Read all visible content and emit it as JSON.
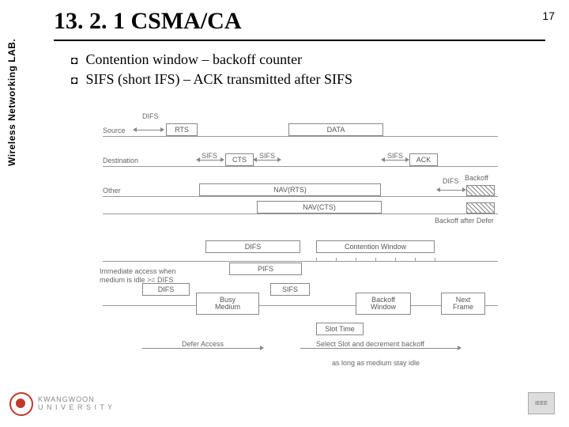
{
  "page": {
    "number": "17"
  },
  "sidebar": {
    "label": "Wireless Networking LAB."
  },
  "brand": {
    "name": "KWANGWOON",
    "sub": "U N I V E R S I T Y"
  },
  "title": "13. 2. 1 CSMA/CA",
  "bullets": [
    "Contention window – backoff counter",
    "SIFS (short IFS) – ACK transmitted after SIFS"
  ],
  "diagram": {
    "rows": {
      "source": "Source",
      "destination": "Destination",
      "other": "Other",
      "immediate1": "Immediate access when",
      "immediate2": "medium is idle >= DIFS"
    },
    "labels": {
      "difs": "DIFS",
      "rts": "RTS",
      "data": "DATA",
      "sifs": "SIFS",
      "cts": "CTS",
      "ack": "ACK",
      "nav_rts": "NAV(RTS)",
      "nav_cts": "NAV(CTS)",
      "backoff": "Backoff",
      "backoff_defer": "Backoff after Defer",
      "pifs": "PIFS",
      "cw": "Contention Window",
      "busy": "Busy",
      "medium": "Medium",
      "bw1": "Backoff",
      "bw2": "Window",
      "next1": "Next",
      "next2": "Frame",
      "slot": "Slot Time",
      "defer": "Defer Access",
      "select": "Select Slot and decrement backoff",
      "aslong": "as long as medium stay idle"
    }
  }
}
